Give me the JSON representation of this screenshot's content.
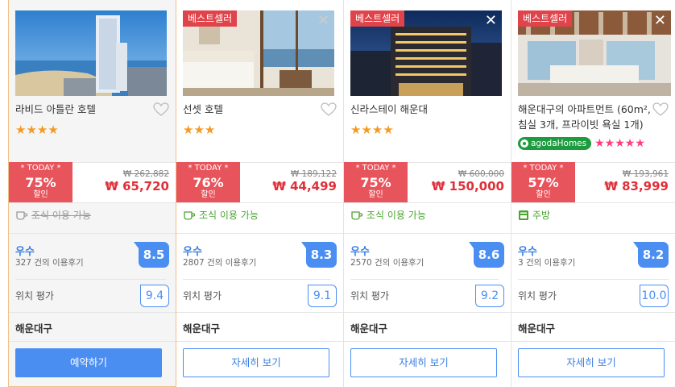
{
  "hotels": [
    {
      "name": "라비드 아틀란 호텔",
      "bestseller": "",
      "stars": "★★★★",
      "today": "* TODAY *",
      "discount": "75%",
      "discount_suffix": "할인",
      "price_old": "₩ 262,882",
      "price_new": "₩ 65,720",
      "amenity": "조식 이용 가능",
      "amenity_available": false,
      "rating_label": "우수",
      "review_count": "327 건의 이용후기",
      "score": "8.5",
      "location_label": "위치 평가",
      "location_score": "9.4",
      "area": "해운대구",
      "button": "예약하기"
    },
    {
      "name": "선셋 호텔",
      "bestseller": "베스트셀러",
      "stars": "★★★",
      "today": "* TODAY *",
      "discount": "76%",
      "discount_suffix": "할인",
      "price_old": "₩ 189,122",
      "price_new": "₩ 44,499",
      "amenity": "조식 이용 가능",
      "amenity_available": true,
      "rating_label": "우수",
      "review_count": "2807 건의 이용후기",
      "score": "8.3",
      "location_label": "위치 평가",
      "location_score": "9.1",
      "area": "해운대구",
      "button": "자세히 보기"
    },
    {
      "name": "신라스테이 해운대",
      "bestseller": "베스트셀러",
      "stars": "★★★★",
      "today": "* TODAY *",
      "discount": "75%",
      "discount_suffix": "할인",
      "price_old": "₩ 600,000",
      "price_new": "₩ 150,000",
      "amenity": "조식 이용 가능",
      "amenity_available": true,
      "rating_label": "우수",
      "review_count": "2570 건의 이용후기",
      "score": "8.6",
      "location_label": "위치 평가",
      "location_score": "9.2",
      "area": "해운대구",
      "button": "자세히 보기"
    },
    {
      "name": "해운대구의 아파트먼트 (60m², 침실 3개, 프라이빗 욕실 1개)",
      "bestseller": "베스트셀러",
      "brand": "agodaHomes",
      "stars": "★★★★★",
      "today": "* TODAY *",
      "discount": "57%",
      "discount_suffix": "할인",
      "price_old": "₩ 193,961",
      "price_new": "₩ 83,999",
      "amenity": "주방",
      "amenity_available": true,
      "rating_label": "우수",
      "review_count": "3 건의 이용후기",
      "score": "8.2",
      "location_label": "위치 평가",
      "location_score": "10.0",
      "area": "해운대구",
      "button": "자세히 보기"
    }
  ],
  "close_glyph": "✕",
  "colors": {
    "accent_blue": "#4a8ef2",
    "deal_red": "#e8545b",
    "price_red": "#e0303a",
    "amenity_green": "#4aa52f",
    "star_orange": "#f59a23",
    "star_pink": "#ff3e7a",
    "agoda_green": "#1c9b3f"
  }
}
